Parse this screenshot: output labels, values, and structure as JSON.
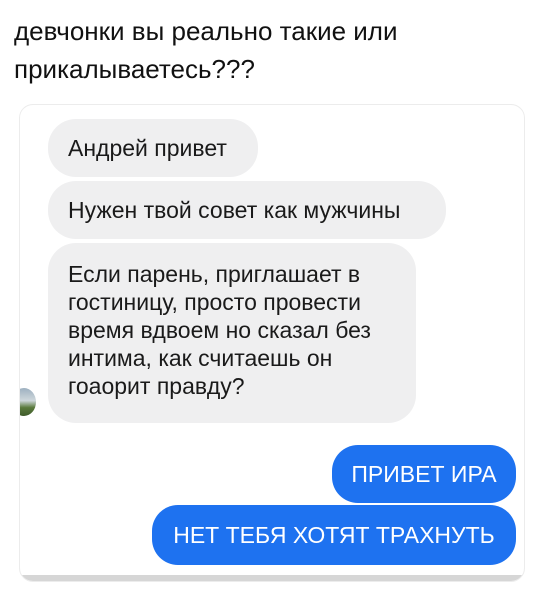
{
  "caption": {
    "line1": "девчонки вы реально такие или",
    "line2": "прикалываетесь???"
  },
  "chat": {
    "incoming": [
      {
        "text": "Андрей привет"
      },
      {
        "text": "Нужен твой совет как мужчины"
      },
      {
        "lines": [
          "Если парень, приглашает в",
          "гостиницу, просто провести",
          "время вдвоем но сказал без",
          "интима, как считаешь он",
          "гоаорит правду?"
        ]
      }
    ],
    "outgoing": [
      {
        "text": "ПРИВЕТ ИРА"
      },
      {
        "text": "НЕТ ТЕБЯ ХОТЯТ ТРАХНУТЬ"
      }
    ]
  },
  "colors": {
    "incoming_bubble": "#efeff0",
    "outgoing_bubble": "#1e72f0"
  }
}
